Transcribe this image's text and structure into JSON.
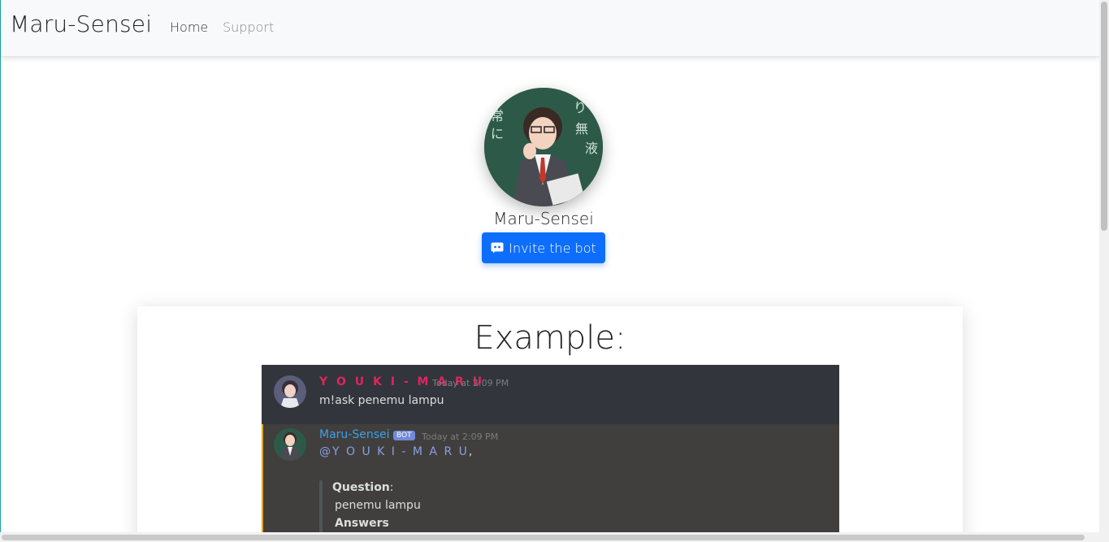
{
  "navbar": {
    "brand": "Maru-Sensei",
    "links": [
      {
        "label": "Home"
      },
      {
        "label": "Support"
      }
    ]
  },
  "profile": {
    "name": "Maru-Sensei",
    "invite_label": "Invite the bot",
    "invite_icon": "discord-icon"
  },
  "card": {
    "title": "Example:"
  },
  "example": {
    "message1": {
      "author": "Y O U K I - M A R U",
      "timestamp": "Today at 2:09 PM",
      "text": "m!ask penemu lampu"
    },
    "message2": {
      "author": "Maru-Sensei",
      "bot_tag": "BOT",
      "timestamp": "Today at 2:09 PM",
      "mention": "@Y O U K I - M A R U",
      "mention_suffix": ",",
      "question_label": "Question",
      "question_colon": ":",
      "question_text": "penemu lampu",
      "answers_label": "Answers"
    }
  },
  "colors": {
    "primary": "#0d6efd",
    "youki_name": "#e0245e",
    "bot_name": "#3ea0ea",
    "bot_tag": "#7289da",
    "mention": "#8a9ee8"
  }
}
